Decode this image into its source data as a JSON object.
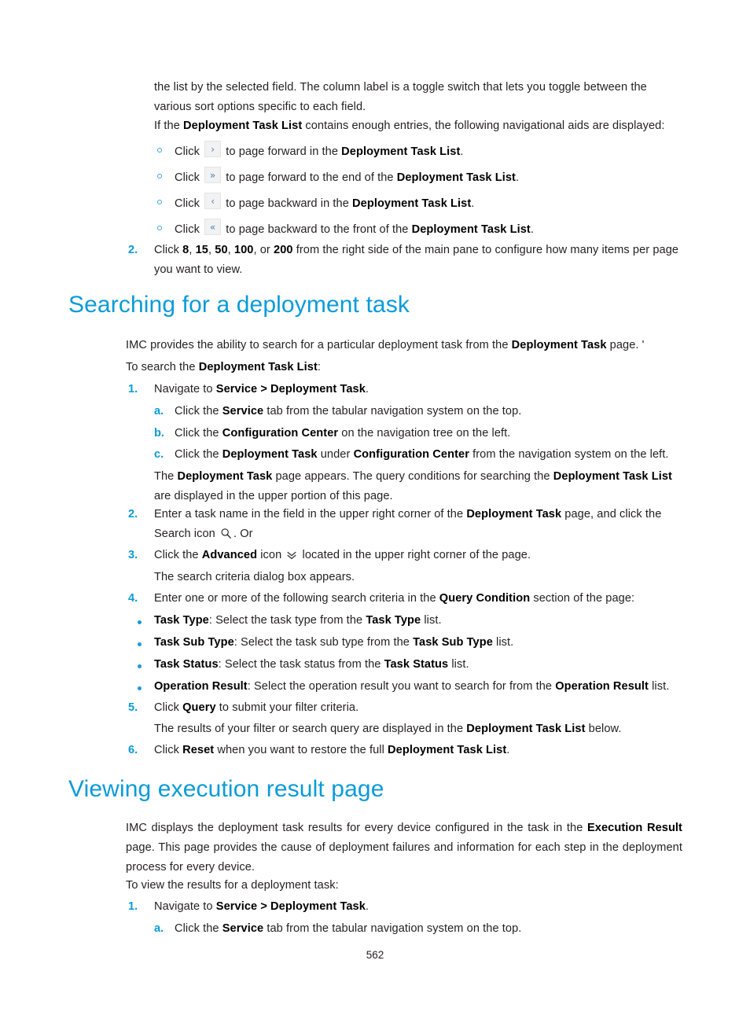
{
  "document": {
    "page_number": "562"
  },
  "intro": {
    "para1": "the list by the selected field. The column label is a toggle switch that lets you toggle between the various sort options specific to each field.",
    "para2_pre": "If the ",
    "para2_bold": "Deployment Task List",
    "para2_post": " contains enough entries, the following navigational aids are displayed:"
  },
  "nav_aids": [
    {
      "click": "Click",
      "icon": "chevron-right-icon",
      "glyph": "›",
      "text_pre": " to page forward in the ",
      "bold": "Deployment Task List",
      "text_post": "."
    },
    {
      "click": "Click",
      "icon": "double-chevron-right-icon",
      "glyph": "»",
      "text_pre": " to page forward to the end of the ",
      "bold": "Deployment Task List",
      "text_post": "."
    },
    {
      "click": "Click",
      "icon": "chevron-left-icon",
      "glyph": "‹",
      "text_pre": " to page backward in the ",
      "bold": "Deployment Task List",
      "text_post": "."
    },
    {
      "click": "Click",
      "icon": "double-chevron-left-icon",
      "glyph": "«",
      "text_pre": " to page backward to the front of the ",
      "bold": "Deployment Task List",
      "text_post": "."
    }
  ],
  "step_items_per_page": {
    "marker": "2.",
    "t1": "Click ",
    "b1": "8",
    "t2": ", ",
    "b2": "15",
    "t3": ", ",
    "b3": "50",
    "t4": ", ",
    "b4": "100",
    "t5": ", or ",
    "b5": "200",
    "t6": " from the right side of the main pane to configure how many items per page you want to view."
  },
  "section_search": {
    "heading": "Searching for a deployment task",
    "intro_pre": "IMC provides the ability to search for a particular deployment task from the ",
    "intro_bold": "Deployment Task",
    "intro_post": " page. '",
    "lead_pre": "To search the ",
    "lead_bold": "Deployment Task List",
    "lead_post": ":",
    "step1": {
      "marker": "1.",
      "pre": "Navigate to ",
      "bold": "Service > Deployment Task",
      "post": "."
    },
    "step1a": {
      "marker": "a.",
      "pre": "Click the ",
      "bold": "Service",
      "post": " tab from the tabular navigation system on the top."
    },
    "step1b": {
      "marker": "b.",
      "pre": "Click the ",
      "bold": "Configuration Center",
      "post": " on the navigation tree on the left."
    },
    "step1c": {
      "marker": "c.",
      "pre": "Click the ",
      "bold1": "Deployment Task",
      "mid": " under ",
      "bold2": "Configuration Center",
      "post": " from the navigation system on the left."
    },
    "step1_note": {
      "t1": "The ",
      "b1": "Deployment Task",
      "t2": " page appears. The query conditions for searching the ",
      "b2": "Deployment Task List",
      "t3": " are displayed in the upper portion of this page."
    },
    "step2": {
      "marker": "2.",
      "t1": "Enter a task name in the field in the upper right corner of the ",
      "b1": "Deployment Task",
      "t2": " page, and click the Search icon ",
      "icon": "search-icon",
      "t3": ". Or"
    },
    "step3": {
      "marker": "3.",
      "t1": "Click the ",
      "b1": "Advanced",
      "t2": " icon ",
      "icon": "double-chevron-down-icon",
      "t3": " located in the upper right corner of the page."
    },
    "step3_note": "The search criteria dialog box appears.",
    "step4": {
      "marker": "4.",
      "t1": "Enter one or more of the following search criteria in the ",
      "b1": "Query Condition",
      "t2": " section of the page:"
    },
    "criteria": [
      {
        "bold": "Task Type",
        "mid": ": Select the task type from the ",
        "bold2": "Task Type",
        "post": " list."
      },
      {
        "bold": "Task Sub Type",
        "mid": ": Select the task sub type from the ",
        "bold2": "Task Sub Type",
        "post": " list."
      },
      {
        "bold": "Task Status",
        "mid": ": Select the task status from the ",
        "bold2": "Task Status",
        "post": " list."
      },
      {
        "bold": "Operation Result",
        "mid": ": Select the operation result you want to search for from the ",
        "bold2": "Operation Result",
        "post": " list."
      }
    ],
    "step5": {
      "marker": "5.",
      "t1": "Click ",
      "b1": "Query",
      "t2": " to submit your filter criteria."
    },
    "step5_note": {
      "t1": "The results of your filter or search query are displayed in the ",
      "b1": "Deployment Task List",
      "t2": " below."
    },
    "step6": {
      "marker": "6.",
      "t1": "Click ",
      "b1": "Reset",
      "t2": " when you want to restore the full ",
      "b2": "Deployment Task List",
      "t3": "."
    }
  },
  "section_viewing": {
    "heading": "Viewing execution result page",
    "intro": {
      "t1": "IMC displays the deployment task results for every device configured in the task in the ",
      "b1": "Execution Result",
      "t2": " page. This page provides the cause of deployment failures and information for each step in the deployment process for every device."
    },
    "lead": "To view the results for a deployment task:",
    "step1": {
      "marker": "1.",
      "pre": "Navigate to ",
      "bold": "Service > Deployment Task",
      "post": "."
    },
    "step1a": {
      "marker": "a.",
      "pre": "Click the ",
      "bold": "Service",
      "post": " tab from the tabular navigation system on the top."
    }
  },
  "colors": {
    "heading": "#0b9bd8",
    "marker": "#0b9bd8",
    "body": "#231f20"
  }
}
